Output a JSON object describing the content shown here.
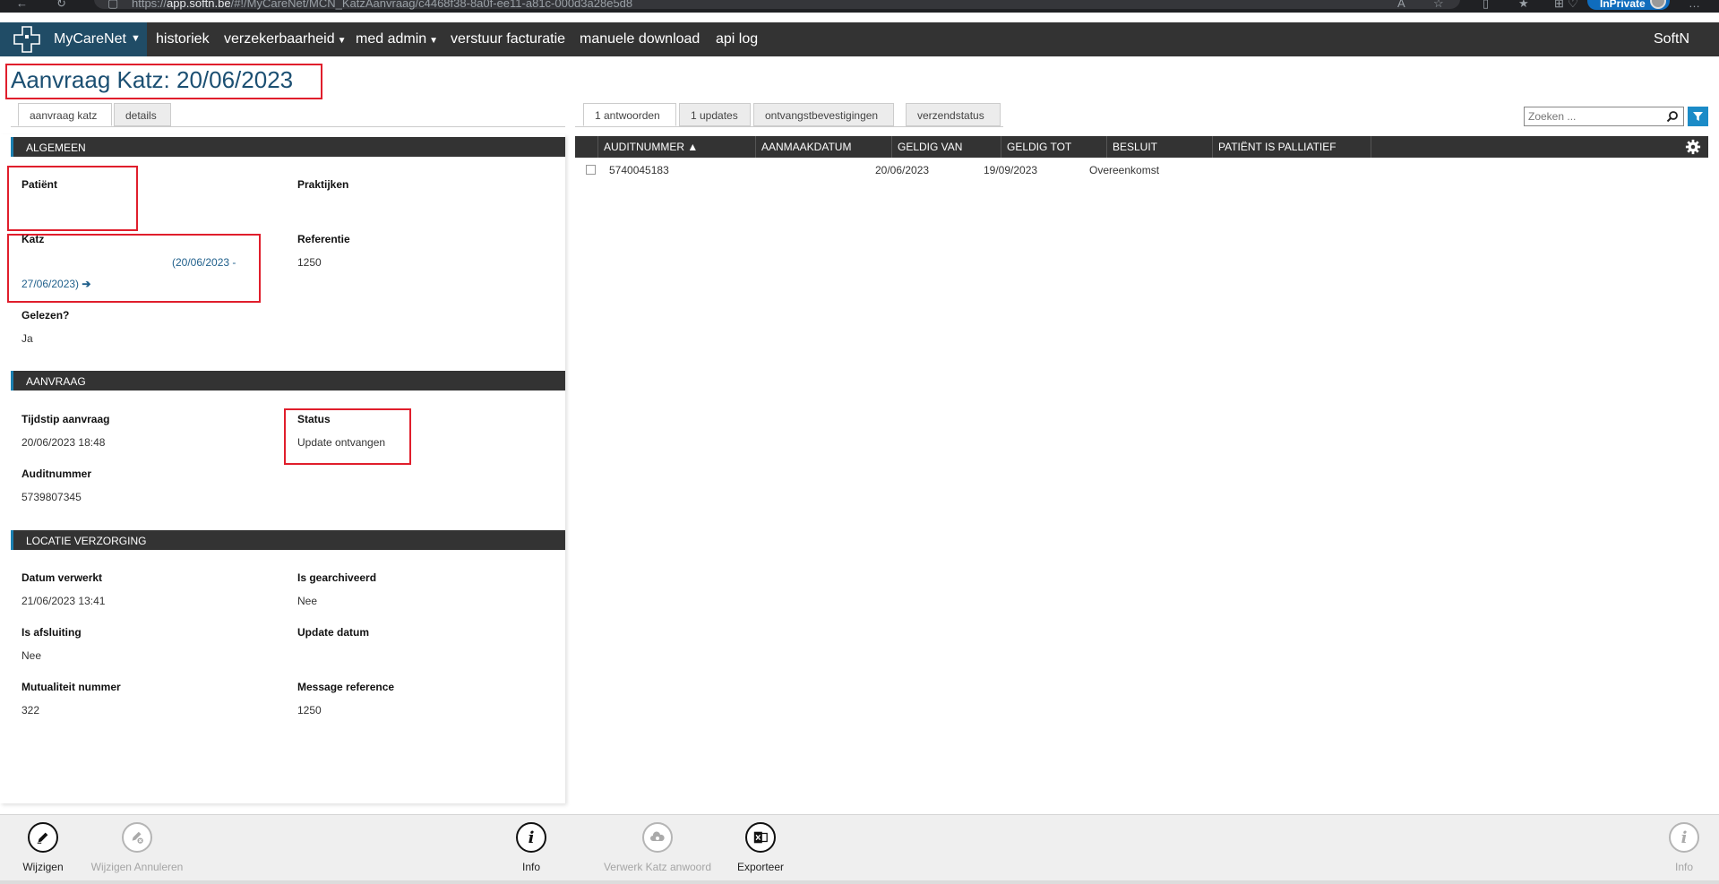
{
  "browser": {
    "url_prefix": "https://",
    "url_host": "app.softn.be",
    "url_path": "/#!/MyCareNet/MCN_KatzAanvraag/c4468f38-8a0f-ee11-a81c-000d3a28e5d8",
    "inprivate_label": "InPrivate"
  },
  "nav": {
    "brand": "MyCareNet",
    "items": [
      "historiek",
      "verzekerbaarheid",
      "med admin",
      "verstuur facturatie",
      "manuele download",
      "api log"
    ],
    "user": "SoftN"
  },
  "page": {
    "title": "Aanvraag Katz: 20/06/2023"
  },
  "left_tabs": [
    "aanvraag katz",
    "details"
  ],
  "sections": {
    "algemeen": {
      "heading": "ALGEMEEN",
      "patient_label": "Patiënt",
      "praktijken_label": "Praktijken",
      "katz_label": "Katz",
      "katz_value_line1": "(20/06/2023 -",
      "katz_value_line2": "27/06/2023)",
      "referentie_label": "Referentie",
      "referentie_value": "1250",
      "gelezen_label": "Gelezen?",
      "gelezen_value": "Ja"
    },
    "aanvraag": {
      "heading": "AANVRAAG",
      "tijdstip_label": "Tijdstip aanvraag",
      "tijdstip_value": "20/06/2023 18:48",
      "status_label": "Status",
      "status_value": "Update ontvangen",
      "auditnummer_label": "Auditnummer",
      "auditnummer_value": "5739807345"
    },
    "locatie": {
      "heading": "LOCATIE VERZORGING",
      "datum_verwerkt_label": "Datum verwerkt",
      "datum_verwerkt_value": "21/06/2023 13:41",
      "gearchiveerd_label": "Is gearchiveerd",
      "gearchiveerd_value": "Nee",
      "afsluiting_label": "Is afsluiting",
      "afsluiting_value": "Nee",
      "update_datum_label": "Update datum",
      "mutualiteit_label": "Mutualiteit nummer",
      "mutualiteit_value": "322",
      "message_ref_label": "Message reference",
      "message_ref_value": "1250"
    }
  },
  "right_tabs": [
    "1 antwoorden",
    "1 updates",
    "ontvangstbevestigingen",
    "verzendstatus"
  ],
  "search": {
    "placeholder": "Zoeken ..."
  },
  "grid": {
    "columns": [
      "AUDITNUMMER",
      "AANMAAKDATUM",
      "GELDIG VAN",
      "GELDIG TOT",
      "BESLUIT",
      "PATIËNT IS PALLIATIEF"
    ],
    "sort_indicator": "▲",
    "rows": [
      {
        "auditnummer": "5740045183",
        "aanmaakdatum": "",
        "geldig_van": "20/06/2023",
        "geldig_tot": "19/09/2023",
        "besluit": "Overeenkomst",
        "palliatief": ""
      }
    ]
  },
  "toolbar": {
    "wijzigen": "Wijzigen",
    "wijzigen_annuleren": "Wijzigen Annuleren",
    "info": "Info",
    "verwerk": "Verwerk Katz anwoord",
    "exporteer": "Exporteer",
    "info_right": "Info"
  },
  "colors": {
    "accent": "#1b8bc7",
    "brand": "#204c66",
    "highlight": "#e01e2c",
    "header": "#333333"
  }
}
